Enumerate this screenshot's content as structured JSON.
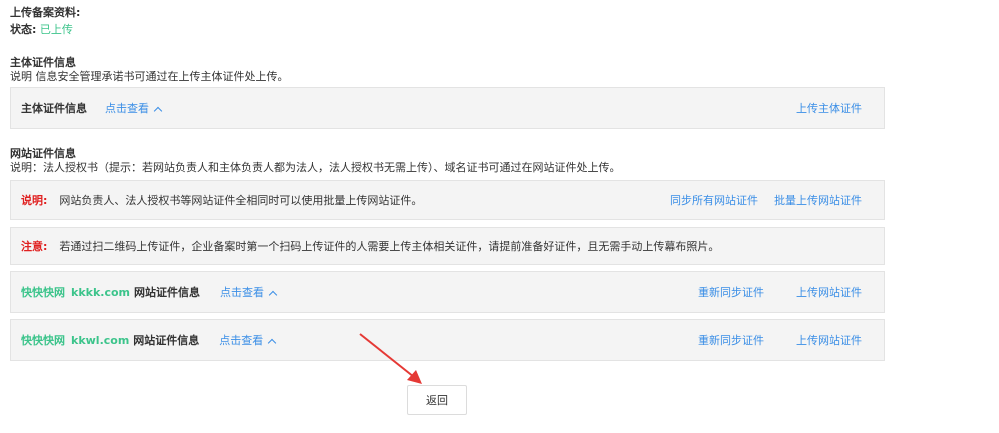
{
  "header": {
    "upload_title": "上传备案资料:",
    "status_label": "状态:",
    "status_value": "已上传"
  },
  "subject": {
    "title": "主体证件信息",
    "desc": "说明 信息安全管理承诺书可通过在上传主体证件处上传。",
    "panel_label": "主体证件信息",
    "view_link": "点击查看",
    "upload_link": "上传主体证件"
  },
  "site": {
    "title": "网站证件信息",
    "desc": "说明：法人授权书（提示：若网站负责人和主体负责人都为法人，法人授权书无需上传）、域名证书可通过在网站证件处上传。",
    "note_label": "说明:",
    "note_text": "网站负责人、法人授权书等网站证件全相同时可以使用批量上传网站证件。",
    "sync_all_link": "同步所有网站证件",
    "batch_upload_link": "批量上传网站证件",
    "attention_label": "注意:",
    "attention_text": "若通过扫二维码上传证件，企业备案时第一个扫码上传证件的人需要上传主体相关证件，请提前准备好证件，且无需手动上传幕布照片。"
  },
  "websites": [
    {
      "name": "快快快网",
      "domain": "kkkk.com",
      "suffix": "网站证件信息",
      "view_link": "点击查看",
      "resync_link": "重新同步证件",
      "upload_link": "上传网站证件"
    },
    {
      "name": "快快快网",
      "domain": "kkwl.com",
      "suffix": "网站证件信息",
      "view_link": "点击查看",
      "resync_link": "重新同步证件",
      "upload_link": "上传网站证件"
    }
  ],
  "footer": {
    "back_label": "返回"
  },
  "colors": {
    "accent_blue": "#3a8ee6",
    "accent_green": "#3cc48b",
    "warning_red": "#e02020",
    "annotation_arrow": "#e53935"
  }
}
